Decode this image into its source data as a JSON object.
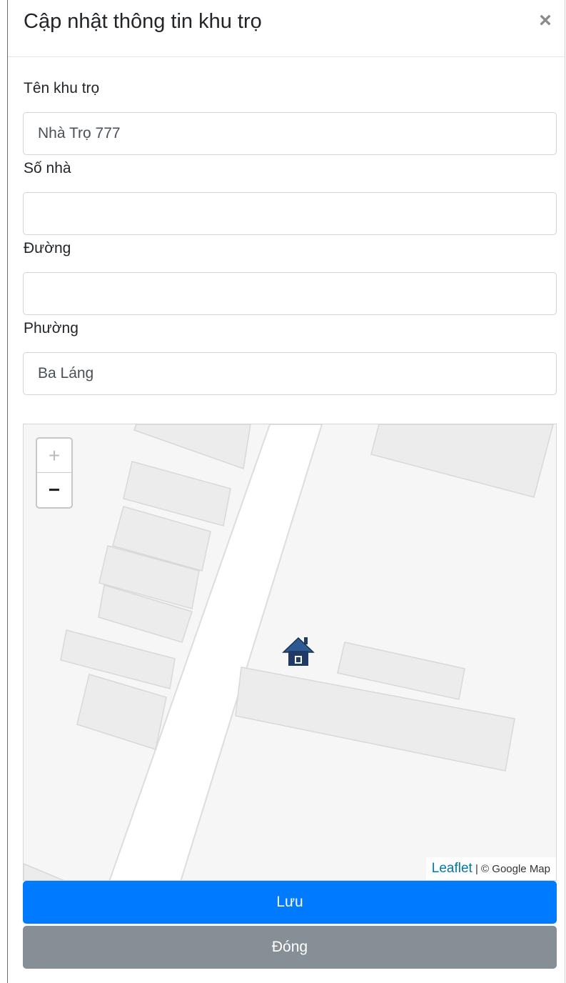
{
  "modal": {
    "title": "Cập nhật thông tin khu trọ",
    "close_symbol": "×"
  },
  "form": {
    "name_label": "Tên khu trọ",
    "name_value": "Nhà Trọ 777",
    "house_number_label": "Số nhà",
    "house_number_value": "",
    "street_label": "Đường",
    "street_value": "",
    "ward_label": "Phường",
    "ward_value": "Ba Láng"
  },
  "map": {
    "zoom_in": "+",
    "zoom_out": "−",
    "attribution_link": "Leaflet",
    "attribution_text": " | © Google Map",
    "marker_icon": "house-marker-icon",
    "marker_color": "#1f3a64"
  },
  "buttons": {
    "save_label": "Lưu",
    "close_label": "Đóng"
  },
  "colors": {
    "primary": "#007bff",
    "secondary": "#868e96"
  }
}
